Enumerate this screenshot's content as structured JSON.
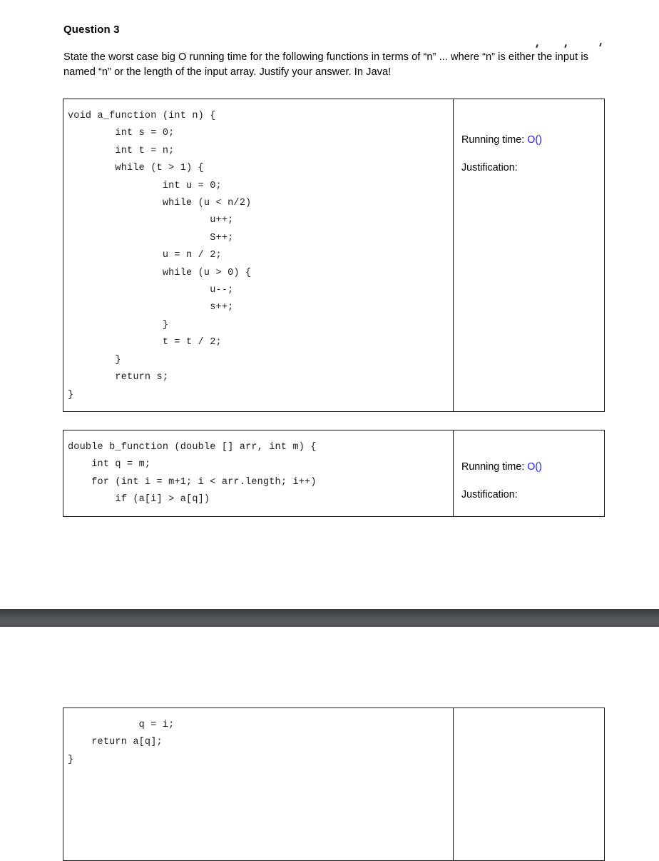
{
  "document": {
    "question_title": "Question 3",
    "prompt": "State the worst case big O running time for the following functions in terms of “n” ... where “n” is either the input is named “n” or the length of the input array. Justify your answer. In Java!"
  },
  "colors": {
    "big_o_accent": "#1f1fe0",
    "page_gap_bar": "#55585b",
    "table_border": "#1a1a1a",
    "text": "#000000"
  },
  "table_rows": [
    {
      "code": "void a_function (int n) {\n        int s = 0;\n        int t = n;\n        while (t > 1) {\n                int u = 0;\n                while (u < n/2)\n                        u++;\n                        S++;\n                u = n / 2;\n                while (u > 0) {\n                        u--;\n                        s++;\n                }\n                t = t / 2;\n        }\n        return s;\n}",
      "running_time_label": "Running time:",
      "running_time_value": "O()",
      "justification_label": "Justification:",
      "justification_value": ""
    },
    {
      "code": "double b_function (double [] arr, int m) {\n    int q = m;\n    for (int i = m+1; i < arr.length; i++)\n        if (a[i] > a[q])",
      "running_time_label": "Running time:",
      "running_time_value": "O()",
      "justification_label": "Justification:",
      "justification_value": ""
    }
  ],
  "page_two": {
    "code": "            q = i;\n    return a[q];\n}",
    "answer": ""
  }
}
